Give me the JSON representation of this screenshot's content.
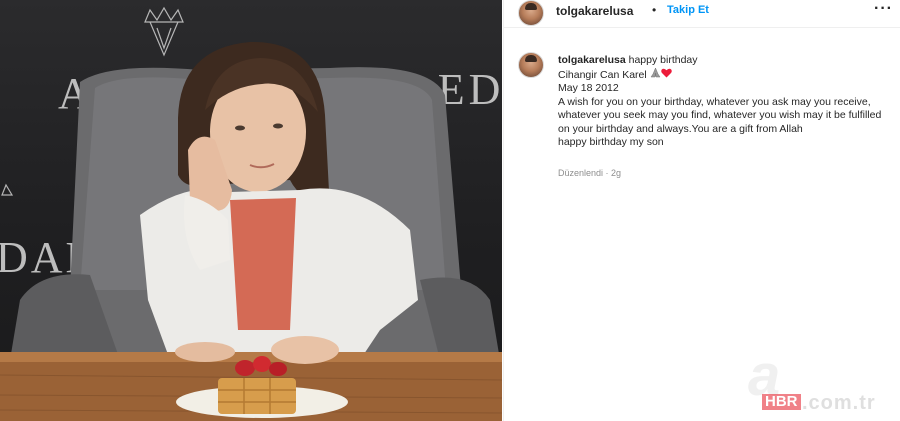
{
  "post": {
    "username": "tolgakarelusa",
    "separator": "•",
    "follow_label": "Takip Et",
    "more_icon": "···",
    "caption": {
      "username": "tolgakarelusa",
      "line1": "happy birthday",
      "line2": "Cihangir Can Karel",
      "line3": "May 18 2012",
      "line4": "A wish for you on your birthday, whatever you ask may you receive, whatever you seek may you find, whatever you wish may it be fulfilled on your birthday and always.You are a gift from Allah",
      "line5": "happy birthday my son"
    },
    "meta": "Düzenlendi · 2g"
  },
  "photo": {
    "wall_letters_left": "ALEDA",
    "wall_letters_right": "AED",
    "wall_letters_side": "DAM"
  },
  "watermark": {
    "letter": "a",
    "brand": "HBR",
    "domain": ".com.tr"
  },
  "colors": {
    "follow_blue": "#0095f6",
    "heart_red": "#ed1c3a",
    "meta_gray": "#8e8e8e"
  }
}
